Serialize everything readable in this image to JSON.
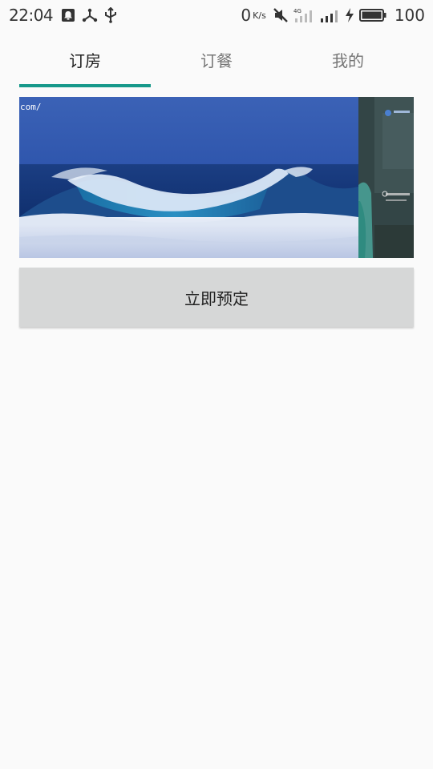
{
  "status_bar": {
    "time": "22:04",
    "net_speed": "0",
    "net_speed_unit": "K/s",
    "network_badge": "4G",
    "battery_percent": "100",
    "left_icons": [
      "notification-icon",
      "share-icon",
      "usb-icon"
    ],
    "right_icons": [
      "mute-icon",
      "signal-4g-icon",
      "signal-icon",
      "charging-icon",
      "battery-icon"
    ]
  },
  "tabs": [
    {
      "label": "订房",
      "active": true
    },
    {
      "label": "订餐",
      "active": false
    },
    {
      "label": "我的",
      "active": false
    }
  ],
  "banner": {
    "url_fragment": "com/",
    "slides": [
      "ocean-wave-image",
      "game-screenshot-image"
    ]
  },
  "book_button": {
    "label": "立即预定"
  },
  "colors": {
    "accent": "#16988a",
    "background": "#fafafa",
    "button_bg": "#d6d7d7",
    "tab_active": "#212121",
    "tab_inactive": "#757575"
  }
}
